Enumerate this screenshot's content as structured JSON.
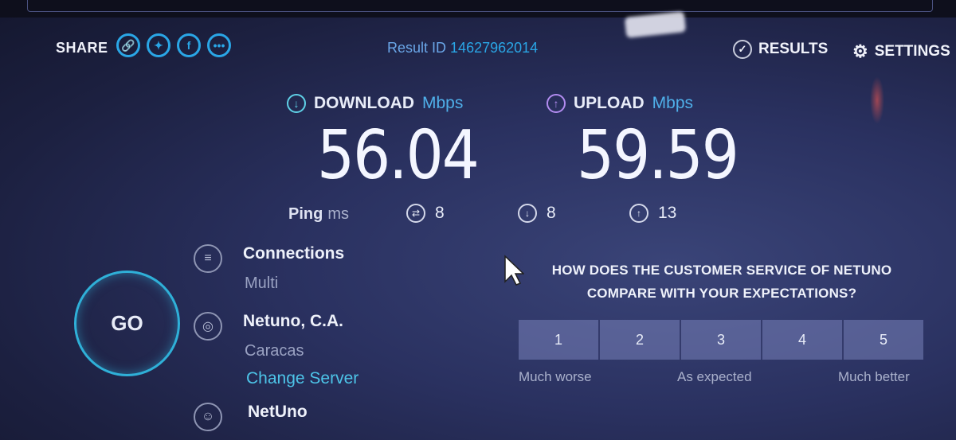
{
  "header": {
    "share_label": "SHARE",
    "share_icons": [
      "link-icon",
      "twitter-icon",
      "facebook-icon",
      "more-icon"
    ],
    "result_id_label": "Result ID",
    "result_id_value": "14627962014",
    "results_label": "RESULTS",
    "settings_label": "SETTINGS"
  },
  "download": {
    "label": "DOWNLOAD",
    "unit": "Mbps",
    "value": "56.04"
  },
  "upload": {
    "label": "UPLOAD",
    "unit": "Mbps",
    "value": "59.59"
  },
  "ping": {
    "label": "Ping",
    "unit": "ms",
    "idle": "8",
    "download": "8",
    "upload": "13"
  },
  "go_label": "GO",
  "connections": {
    "title": "Connections",
    "value": "Multi"
  },
  "server": {
    "name": "Netuno, C.A.",
    "city": "Caracas",
    "change_link": "Change Server"
  },
  "isp": {
    "name": "NetUno"
  },
  "survey": {
    "question_line1": "HOW DOES THE CUSTOMER SERVICE OF NETUNO",
    "question_line2": "COMPARE WITH YOUR EXPECTATIONS?",
    "options": [
      "1",
      "2",
      "3",
      "4",
      "5"
    ],
    "label_low": "Much worse",
    "label_mid": "As expected",
    "label_high": "Much better"
  },
  "colors": {
    "accent": "#2aa6e6",
    "download": "#5fd0e6",
    "upload": "#b28cf0",
    "link": "#4dc4e8"
  }
}
